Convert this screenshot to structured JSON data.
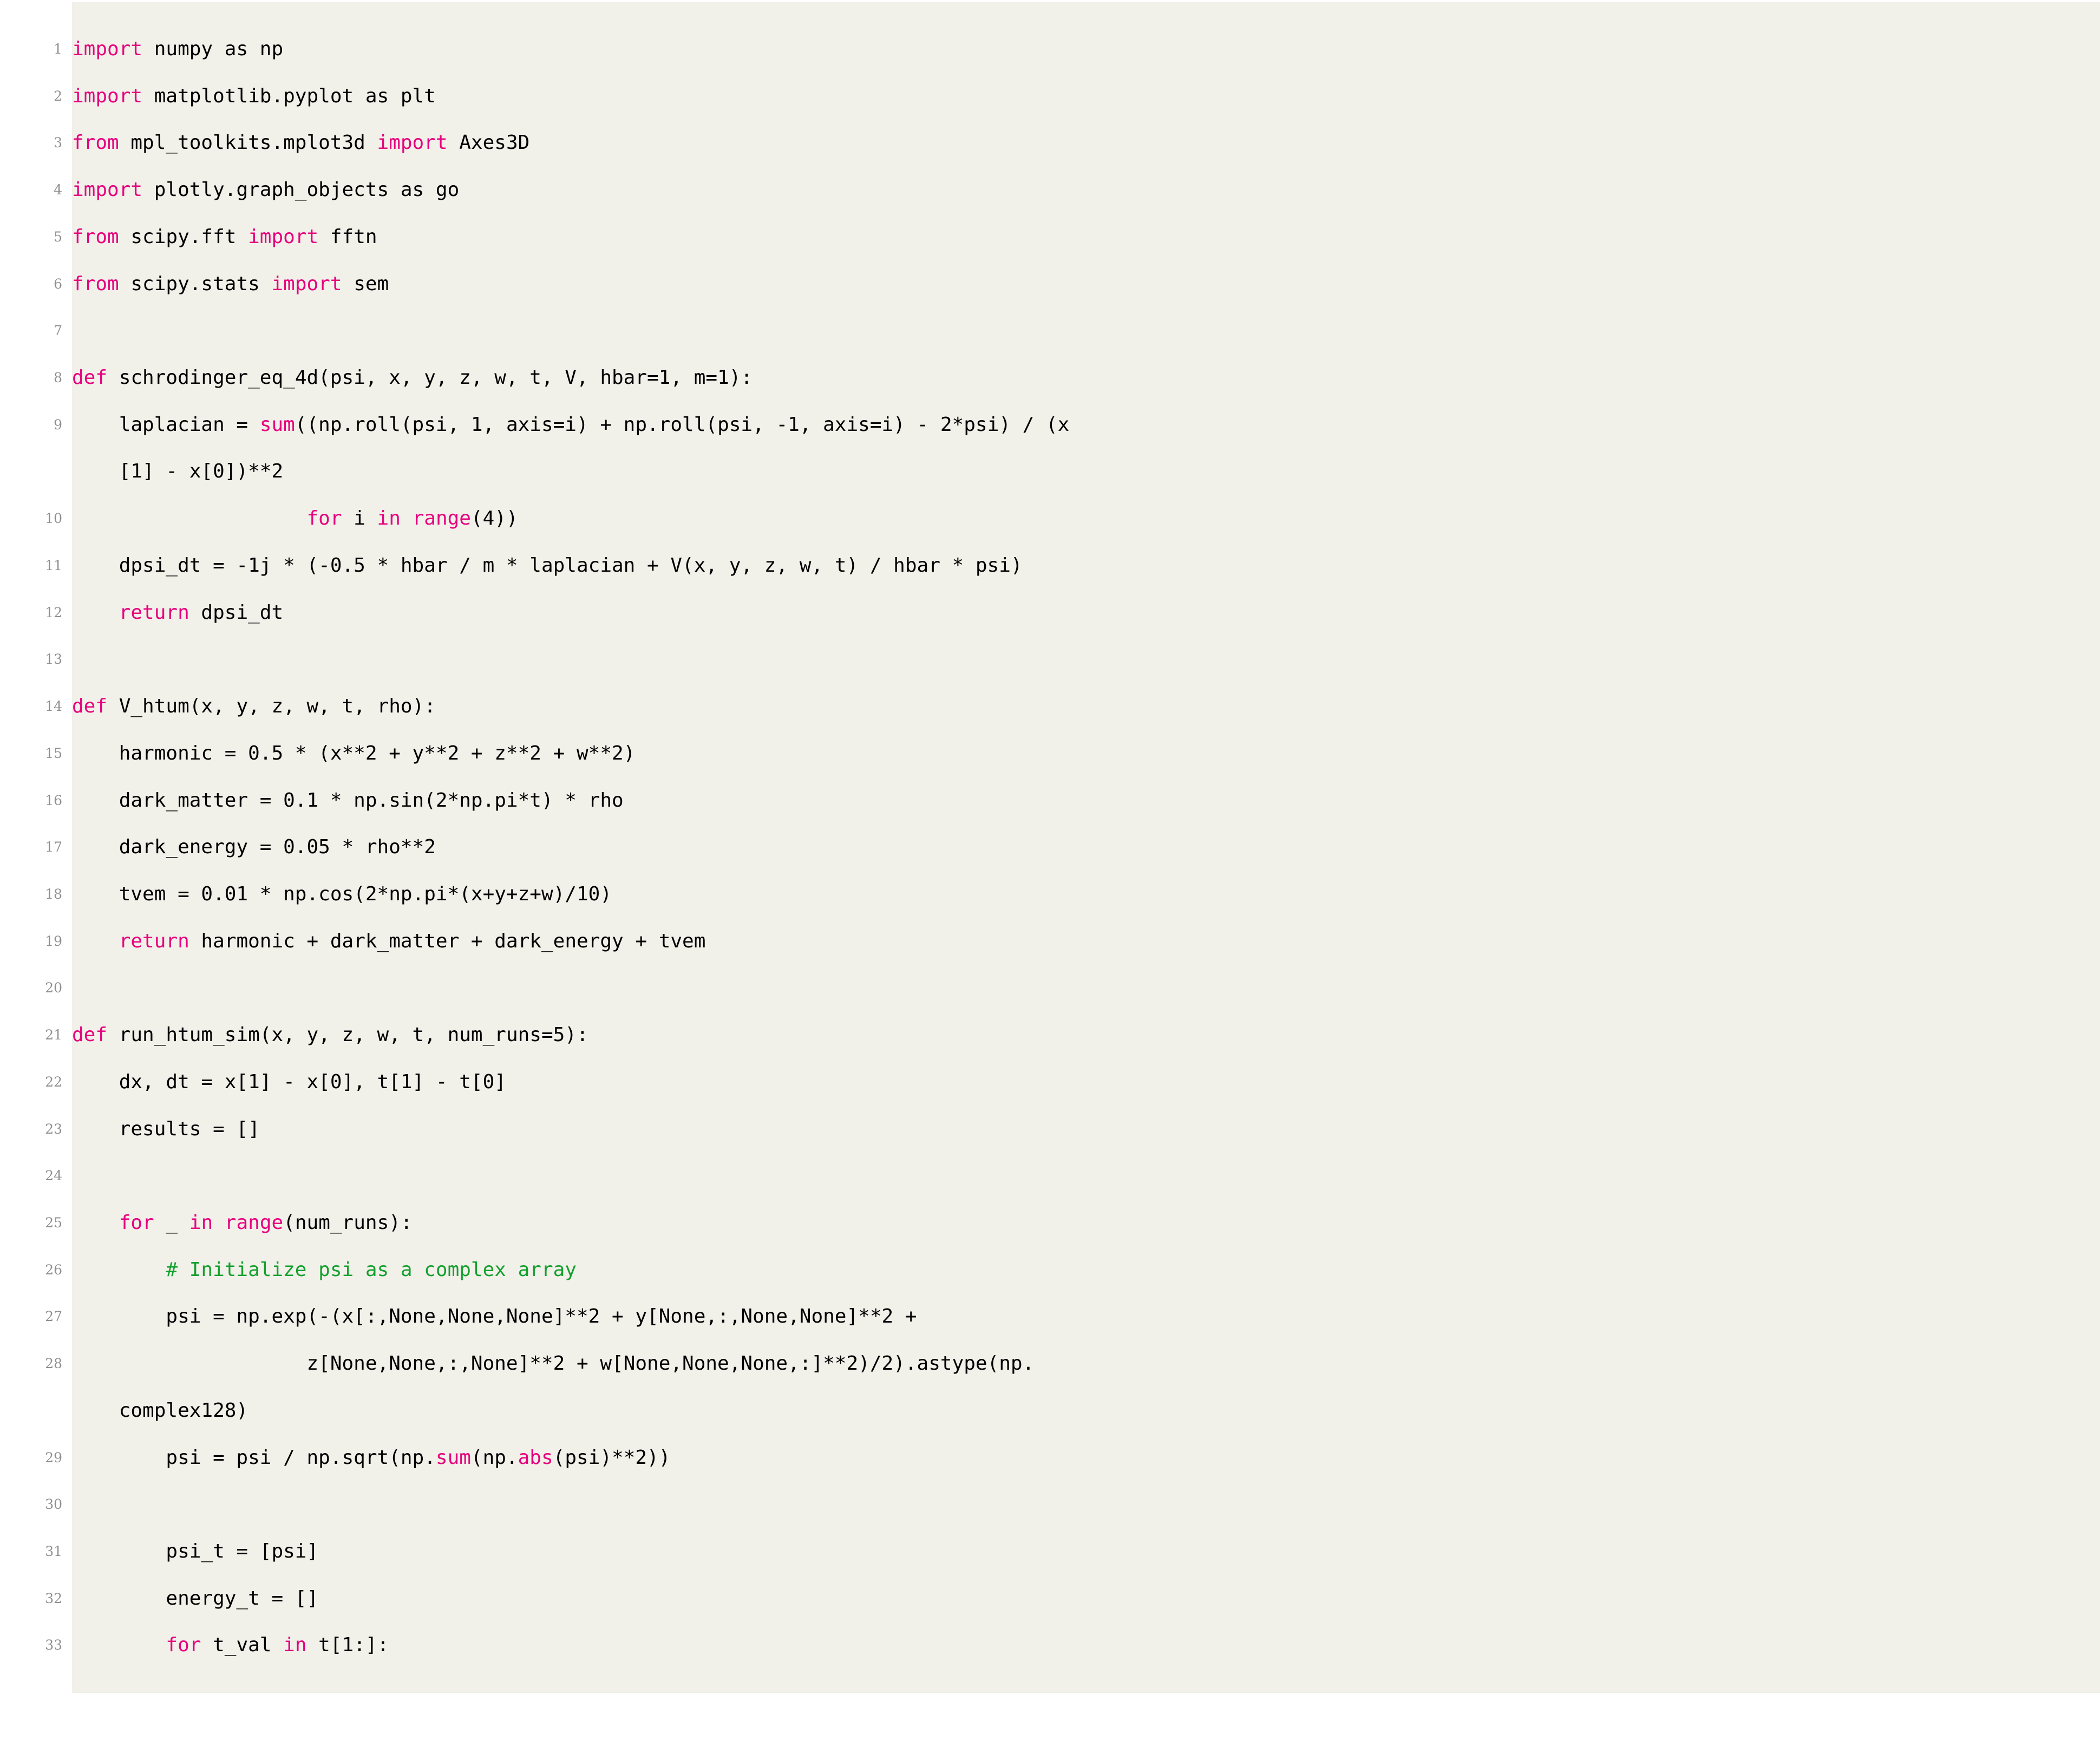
{
  "listing": {
    "language": "Python",
    "style": "latex-listings",
    "colors": {
      "background": "#F1F0E9",
      "page": "#FFFFFF",
      "keyword": "#E6007E",
      "builtin": "#E6007E",
      "comment": "#14A02E",
      "text": "#000000",
      "linenumber": "#8F8F8F"
    },
    "first_line": 1,
    "last_line": 33,
    "lines": [
      {
        "n": "1",
        "tokens": [
          {
            "t": "import",
            "c": "kw"
          },
          {
            "t": " numpy as np",
            "c": "nm"
          }
        ]
      },
      {
        "n": "2",
        "tokens": [
          {
            "t": "import",
            "c": "kw"
          },
          {
            "t": " matplotlib.pyplot as plt",
            "c": "nm"
          }
        ]
      },
      {
        "n": "3",
        "tokens": [
          {
            "t": "from",
            "c": "kw"
          },
          {
            "t": " mpl_toolkits.mplot3d ",
            "c": "nm"
          },
          {
            "t": "import",
            "c": "kw"
          },
          {
            "t": " Axes3D",
            "c": "nm"
          }
        ]
      },
      {
        "n": "4",
        "tokens": [
          {
            "t": "import",
            "c": "kw"
          },
          {
            "t": " plotly.graph_objects as go",
            "c": "nm"
          }
        ]
      },
      {
        "n": "5",
        "tokens": [
          {
            "t": "from",
            "c": "kw"
          },
          {
            "t": " scipy.fft ",
            "c": "nm"
          },
          {
            "t": "import",
            "c": "kw"
          },
          {
            "t": " fftn",
            "c": "nm"
          }
        ]
      },
      {
        "n": "6",
        "tokens": [
          {
            "t": "from",
            "c": "kw"
          },
          {
            "t": " scipy.stats ",
            "c": "nm"
          },
          {
            "t": "import",
            "c": "kw"
          },
          {
            "t": " sem",
            "c": "nm"
          }
        ]
      },
      {
        "n": "7",
        "tokens": []
      },
      {
        "n": "8",
        "tokens": [
          {
            "t": "def",
            "c": "kw"
          },
          {
            "t": " schrodinger_eq_4d(psi, x, y, z, w, t, V, hbar=1, m=1):",
            "c": "nm"
          }
        ]
      },
      {
        "n": "9",
        "tokens": [
          {
            "t": "    laplacian = ",
            "c": "nm"
          },
          {
            "t": "sum",
            "c": "bi"
          },
          {
            "t": "((np.roll(psi, 1, axis=i) + np.roll(psi, -1, axis=i) - 2*psi) / (x",
            "c": "nm"
          }
        ]
      },
      {
        "n": "",
        "cont": true,
        "tokens": [
          {
            "t": "    [1] - x[0])**2",
            "c": "nm"
          }
        ]
      },
      {
        "n": "10",
        "tokens": [
          {
            "t": "                    ",
            "c": "nm"
          },
          {
            "t": "for",
            "c": "kw"
          },
          {
            "t": " i ",
            "c": "nm"
          },
          {
            "t": "in",
            "c": "kw"
          },
          {
            "t": " ",
            "c": "nm"
          },
          {
            "t": "range",
            "c": "bi"
          },
          {
            "t": "(4))",
            "c": "nm"
          }
        ]
      },
      {
        "n": "11",
        "tokens": [
          {
            "t": "    dpsi_dt = -1j * (-0.5 * hbar / m * laplacian + V(x, y, z, w, t) / hbar * psi)",
            "c": "nm"
          }
        ]
      },
      {
        "n": "12",
        "tokens": [
          {
            "t": "    ",
            "c": "nm"
          },
          {
            "t": "return",
            "c": "kw"
          },
          {
            "t": " dpsi_dt",
            "c": "nm"
          }
        ]
      },
      {
        "n": "13",
        "tokens": []
      },
      {
        "n": "14",
        "tokens": [
          {
            "t": "def",
            "c": "kw"
          },
          {
            "t": " V_htum(x, y, z, w, t, rho):",
            "c": "nm"
          }
        ]
      },
      {
        "n": "15",
        "tokens": [
          {
            "t": "    harmonic = 0.5 * (x**2 + y**2 + z**2 + w**2)",
            "c": "nm"
          }
        ]
      },
      {
        "n": "16",
        "tokens": [
          {
            "t": "    dark_matter = 0.1 * np.sin(2*np.pi*t) * rho",
            "c": "nm"
          }
        ]
      },
      {
        "n": "17",
        "tokens": [
          {
            "t": "    dark_energy = 0.05 * rho**2",
            "c": "nm"
          }
        ]
      },
      {
        "n": "18",
        "tokens": [
          {
            "t": "    tvem = 0.01 * np.cos(2*np.pi*(x+y+z+w)/10)",
            "c": "nm"
          }
        ]
      },
      {
        "n": "19",
        "tokens": [
          {
            "t": "    ",
            "c": "nm"
          },
          {
            "t": "return",
            "c": "kw"
          },
          {
            "t": " harmonic + dark_matter + dark_energy + tvem",
            "c": "nm"
          }
        ]
      },
      {
        "n": "20",
        "tokens": []
      },
      {
        "n": "21",
        "tokens": [
          {
            "t": "def",
            "c": "kw"
          },
          {
            "t": " run_htum_sim(x, y, z, w, t, num_runs=5):",
            "c": "nm"
          }
        ]
      },
      {
        "n": "22",
        "tokens": [
          {
            "t": "    dx, dt = x[1] - x[0], t[1] - t[0]",
            "c": "nm"
          }
        ]
      },
      {
        "n": "23",
        "tokens": [
          {
            "t": "    results = []",
            "c": "nm"
          }
        ]
      },
      {
        "n": "24",
        "tokens": []
      },
      {
        "n": "25",
        "tokens": [
          {
            "t": "    ",
            "c": "nm"
          },
          {
            "t": "for",
            "c": "kw"
          },
          {
            "t": " _ ",
            "c": "nm"
          },
          {
            "t": "in",
            "c": "kw"
          },
          {
            "t": " ",
            "c": "nm"
          },
          {
            "t": "range",
            "c": "bi"
          },
          {
            "t": "(num_runs):",
            "c": "nm"
          }
        ]
      },
      {
        "n": "26",
        "tokens": [
          {
            "t": "        # Initialize psi as a complex array",
            "c": "cm"
          }
        ]
      },
      {
        "n": "27",
        "tokens": [
          {
            "t": "        psi = np.exp(-(x[:,None,None,None]**2 + y[None,:,None,None]**2 +",
            "c": "nm"
          }
        ]
      },
      {
        "n": "28",
        "tokens": [
          {
            "t": "                    z[None,None,:,None]**2 + w[None,None,None,:]**2)/2).astype(np.",
            "c": "nm"
          }
        ]
      },
      {
        "n": "",
        "cont": true,
        "tokens": [
          {
            "t": "    complex128)",
            "c": "nm"
          }
        ]
      },
      {
        "n": "29",
        "tokens": [
          {
            "t": "        psi = psi / np.sqrt(np.",
            "c": "nm"
          },
          {
            "t": "sum",
            "c": "bi"
          },
          {
            "t": "(np.",
            "c": "nm"
          },
          {
            "t": "abs",
            "c": "bi"
          },
          {
            "t": "(psi)**2))",
            "c": "nm"
          }
        ]
      },
      {
        "n": "30",
        "tokens": []
      },
      {
        "n": "31",
        "tokens": [
          {
            "t": "        psi_t = [psi]",
            "c": "nm"
          }
        ]
      },
      {
        "n": "32",
        "tokens": [
          {
            "t": "        energy_t = []",
            "c": "nm"
          }
        ]
      },
      {
        "n": "33",
        "tokens": [
          {
            "t": "        ",
            "c": "nm"
          },
          {
            "t": "for",
            "c": "kw"
          },
          {
            "t": " t_val ",
            "c": "nm"
          },
          {
            "t": "in",
            "c": "kw"
          },
          {
            "t": " t[1:]:",
            "c": "nm"
          }
        ]
      }
    ]
  }
}
